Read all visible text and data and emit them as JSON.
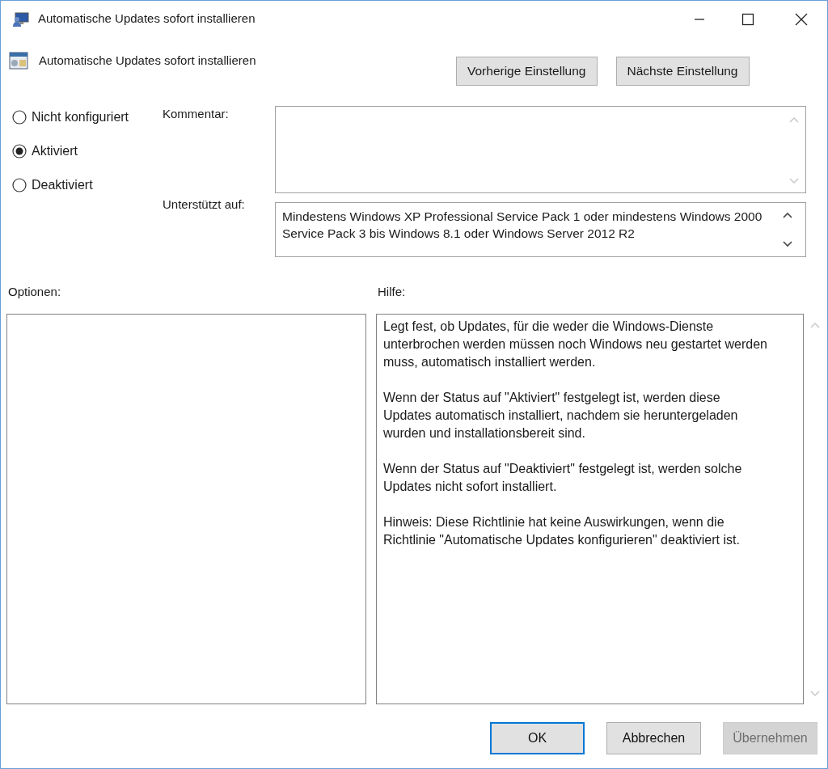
{
  "window": {
    "title": "Automatische Updates sofort installieren"
  },
  "header": {
    "title": "Automatische Updates sofort installieren"
  },
  "nav_buttons": [
    "Vorherige Einstellung",
    "Nächste Einstellung"
  ],
  "state_options": [
    {
      "label": "Nicht konfiguriert",
      "selected": false
    },
    {
      "label": "Aktiviert",
      "selected": true
    },
    {
      "label": "Deaktiviert",
      "selected": false
    }
  ],
  "comment": {
    "label": "Kommentar:"
  },
  "supported": {
    "label": "Unterstützt auf:",
    "value": "Mindestens Windows XP Professional Service Pack 1 oder mindestens Windows 2000 Service Pack 3 bis Windows 8.1 oder Windows Server 2012 R2"
  },
  "options": {
    "label": "Optionen:"
  },
  "help": {
    "label": "Hilfe:",
    "paragraphs": [
      "Legt fest, ob Updates, für die weder die Windows-Dienste unterbrochen werden müssen noch Windows neu gestartet werden muss, automatisch installiert werden.",
      "Wenn der Status auf \"Aktiviert\" festgelegt ist, werden diese Updates automatisch installiert, nachdem sie heruntergeladen wurden und installationsbereit sind.",
      "Wenn der Status auf \"Deaktiviert\" festgelegt ist, werden solche Updates nicht sofort installiert.",
      "Hinweis: Diese Richtlinie hat keine Auswirkungen, wenn die Richtlinie \"Automatische Updates konfigurieren\" deaktiviert ist."
    ]
  },
  "footer_buttons": [
    {
      "label": "OK",
      "kind": "default",
      "disabled": false
    },
    {
      "label": "Abbrechen",
      "kind": "normal",
      "disabled": false
    },
    {
      "label": "Übernehmen",
      "kind": "normal",
      "disabled": true
    }
  ]
}
